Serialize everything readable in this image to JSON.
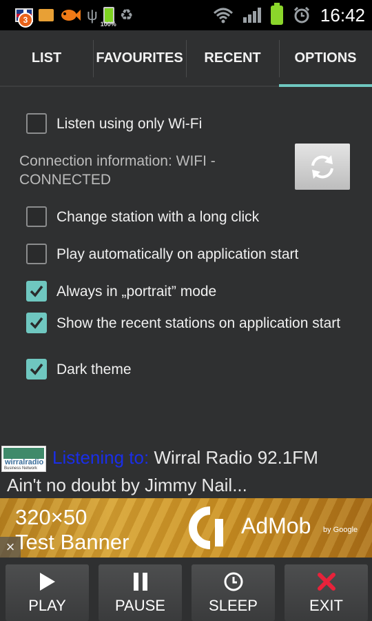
{
  "status_bar": {
    "notification_count": "3",
    "battery_small_label": "100%",
    "time": "16:42"
  },
  "tabs": [
    {
      "label": "LIST"
    },
    {
      "label": "FAVOURITES"
    },
    {
      "label": "RECENT"
    },
    {
      "label": "OPTIONS",
      "active": true
    }
  ],
  "options": {
    "wifi_only": {
      "label": "Listen using only Wi-Fi",
      "checked": false
    },
    "connection_info": "Connection information: WIFI - CONNECTED",
    "long_click": {
      "label": "Change station with a long click",
      "checked": false
    },
    "autoplay": {
      "label": "Play automatically on application start",
      "checked": false
    },
    "portrait": {
      "label": "Always in „portrait” mode",
      "checked": true
    },
    "recent_on_start": {
      "label": "Show the recent stations on application start",
      "checked": true
    },
    "dark_theme": {
      "label": "Dark theme",
      "checked": true
    }
  },
  "now_playing": {
    "logo_name": "wirralradio",
    "logo_sub": "Business Network",
    "prefix": "Listening to:",
    "station": "Wirral Radio 92.1FM",
    "track": "Ain't no doubt by Jimmy Nail..."
  },
  "ad": {
    "line1": "320×50",
    "line2": "Test Banner",
    "brand": "AdMob",
    "by": "by Google",
    "close": "×"
  },
  "controls": [
    {
      "label": "PLAY",
      "icon": "play-icon"
    },
    {
      "label": "PAUSE",
      "icon": "pause-icon"
    },
    {
      "label": "SLEEP",
      "icon": "clock-icon"
    },
    {
      "label": "EXIT",
      "icon": "close-icon"
    }
  ],
  "colors": {
    "accent": "#6fc7c0",
    "background": "#2f3031",
    "listening_prefix": "#1a2ee8",
    "exit_icon": "#e8223a"
  }
}
